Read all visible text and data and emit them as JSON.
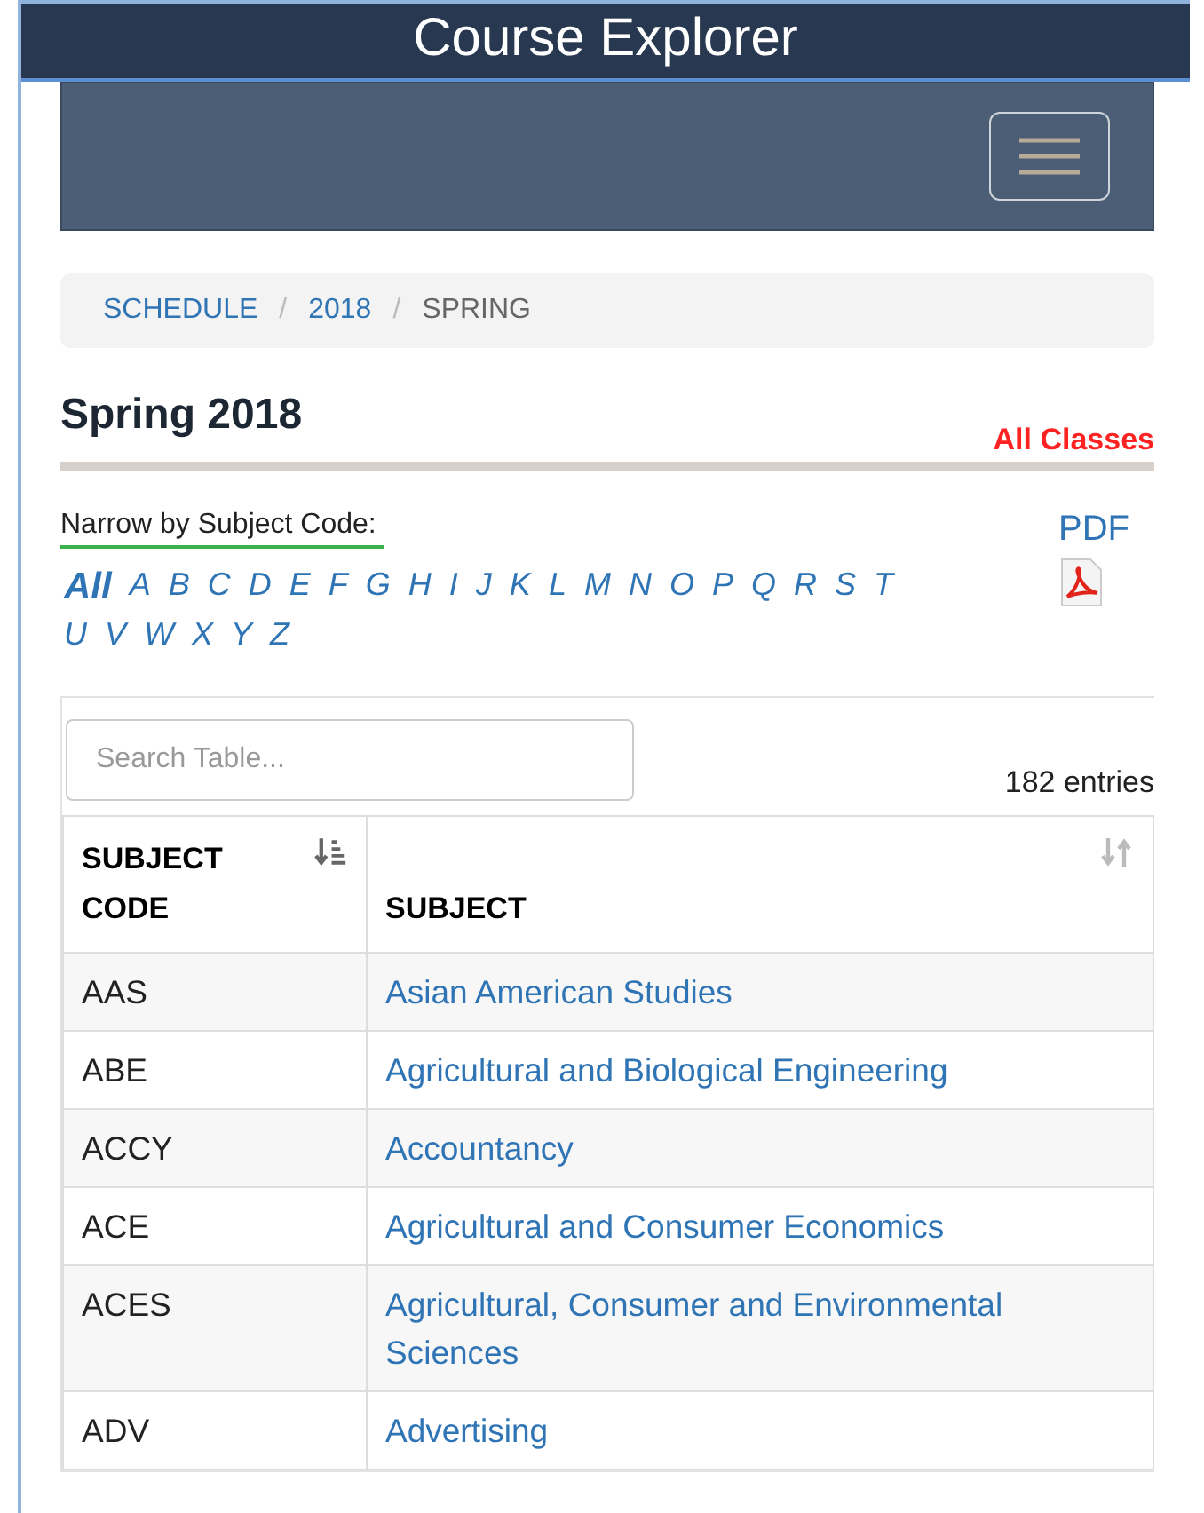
{
  "window": {
    "title": "Course Explorer"
  },
  "breadcrumb": [
    {
      "label": "SCHEDULE",
      "kind": "link"
    },
    {
      "label": "/",
      "kind": "separator"
    },
    {
      "label": "2018",
      "kind": "link"
    },
    {
      "label": "/",
      "kind": "separator"
    },
    {
      "label": "SPRING",
      "kind": "current"
    }
  ],
  "heading": "Spring 2018",
  "filter_badge": "All Classes",
  "narrow_label": "Narrow by Subject Code:",
  "letters": [
    {
      "label": "All",
      "selected": true
    },
    {
      "label": "A",
      "selected": false
    },
    {
      "label": "B",
      "selected": false
    },
    {
      "label": "C",
      "selected": false
    },
    {
      "label": "D",
      "selected": false
    },
    {
      "label": "E",
      "selected": false
    },
    {
      "label": "F",
      "selected": false
    },
    {
      "label": "G",
      "selected": false
    },
    {
      "label": "H",
      "selected": false
    },
    {
      "label": "I",
      "selected": false
    },
    {
      "label": "J",
      "selected": false
    },
    {
      "label": "K",
      "selected": false
    },
    {
      "label": "L",
      "selected": false
    },
    {
      "label": "M",
      "selected": false
    },
    {
      "label": "N",
      "selected": false
    },
    {
      "label": "O",
      "selected": false
    },
    {
      "label": "P",
      "selected": false
    },
    {
      "label": "Q",
      "selected": false
    },
    {
      "label": "R",
      "selected": false
    },
    {
      "label": "S",
      "selected": false
    },
    {
      "label": "T",
      "selected": false
    },
    {
      "label": "U",
      "selected": false
    },
    {
      "label": "V",
      "selected": false
    },
    {
      "label": "W",
      "selected": false
    },
    {
      "label": "X",
      "selected": false
    },
    {
      "label": "Y",
      "selected": false
    },
    {
      "label": "Z",
      "selected": false
    }
  ],
  "pdf": {
    "label": "PDF"
  },
  "search": {
    "placeholder": "Search Table..."
  },
  "entries": "182 entries",
  "table": {
    "columns": [
      {
        "label": "SUBJECT CODE",
        "sorted": true
      },
      {
        "label": "SUBJECT",
        "sorted": false
      }
    ],
    "rows": [
      {
        "code": "AAS",
        "subject": "Asian American Studies"
      },
      {
        "code": "ABE",
        "subject": "Agricultural and Biological Engineering"
      },
      {
        "code": "ACCY",
        "subject": "Accountancy"
      },
      {
        "code": "ACE",
        "subject": "Agricultural and Consumer Economics"
      },
      {
        "code": "ACES",
        "subject": "Agricultural, Consumer and Environmental Sciences"
      },
      {
        "code": "ADV",
        "subject": "Advertising"
      }
    ]
  }
}
